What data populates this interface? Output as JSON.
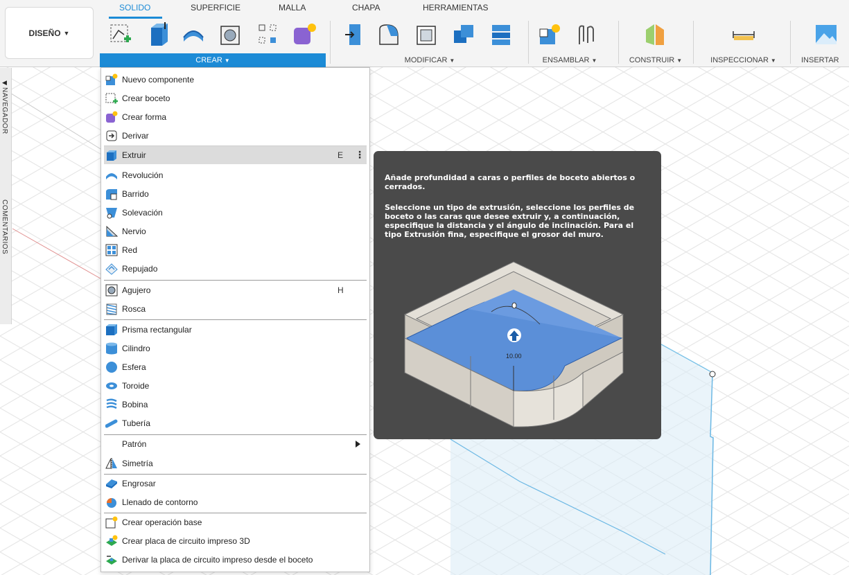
{
  "toolbar": {
    "workspace_label": "DISEÑO",
    "tabs": [
      {
        "label": "SOLIDO",
        "active": true
      },
      {
        "label": "SUPERFICIE",
        "active": false
      },
      {
        "label": "MALLA",
        "active": false
      },
      {
        "label": "CHAPA",
        "active": false
      },
      {
        "label": "HERRAMIENTAS",
        "active": false
      }
    ],
    "groups": {
      "crear": "CREAR",
      "modificar": "MODIFICAR",
      "ensamblar": "ENSAMBLAR",
      "construir": "CONSTRUIR",
      "inspeccionar": "INSPECCIONAR",
      "insertar": "INSERTAR"
    },
    "accent_color": "#1c8bd6"
  },
  "side_panel": {
    "navigator_label": "NAVEGADOR",
    "comments_label": "COMENTARIOS"
  },
  "menu": {
    "items": [
      {
        "label": "Nuevo componente",
        "icon": "new-component-icon"
      },
      {
        "label": "Crear boceto",
        "icon": "create-sketch-icon"
      },
      {
        "label": "Crear forma",
        "icon": "create-form-icon"
      },
      {
        "label": "Derivar",
        "icon": "derive-icon"
      },
      {
        "label": "Extruir",
        "icon": "extrude-icon",
        "shortcut": "E",
        "highlighted": true
      },
      {
        "label": "Revolución",
        "icon": "revolve-icon"
      },
      {
        "label": "Barrido",
        "icon": "sweep-icon"
      },
      {
        "label": "Solevación",
        "icon": "loft-icon"
      },
      {
        "label": "Nervio",
        "icon": "rib-icon"
      },
      {
        "label": "Red",
        "icon": "web-icon"
      },
      {
        "label": "Repujado",
        "icon": "emboss-icon"
      },
      {
        "label": "Agujero",
        "icon": "hole-icon",
        "shortcut": "H"
      },
      {
        "label": "Rosca",
        "icon": "thread-icon"
      },
      {
        "label": "Prisma rectangular",
        "icon": "box-icon"
      },
      {
        "label": "Cilindro",
        "icon": "cylinder-icon"
      },
      {
        "label": "Esfera",
        "icon": "sphere-icon"
      },
      {
        "label": "Toroide",
        "icon": "torus-icon"
      },
      {
        "label": "Bobina",
        "icon": "coil-icon"
      },
      {
        "label": "Tubería",
        "icon": "pipe-icon"
      },
      {
        "label": "Patrón",
        "submenu": true
      },
      {
        "label": "Simetría",
        "icon": "mirror-icon"
      },
      {
        "label": "Engrosar",
        "icon": "thicken-icon"
      },
      {
        "label": "Llenado de contorno",
        "icon": "boundary-fill-icon"
      },
      {
        "label": "Crear operación base",
        "icon": "base-feature-icon"
      },
      {
        "label": "Crear placa de circuito impreso 3D",
        "icon": "pcb-3d-icon"
      },
      {
        "label": "Derivar la placa de circuito impreso desde el boceto",
        "icon": "pcb-derive-icon"
      }
    ]
  },
  "tooltip": {
    "summary": "Añade profundidad a caras o perfiles de boceto abiertos o cerrados.",
    "detail": "Seleccione un tipo de extrusión, seleccione los perfiles de boceto o las caras que desee extruir y, a continuación, especifique la distancia y el ángulo de inclinación. Para el tipo Extrusión fina, especifique el grosor del muro.",
    "illustration_value": "10.00"
  }
}
